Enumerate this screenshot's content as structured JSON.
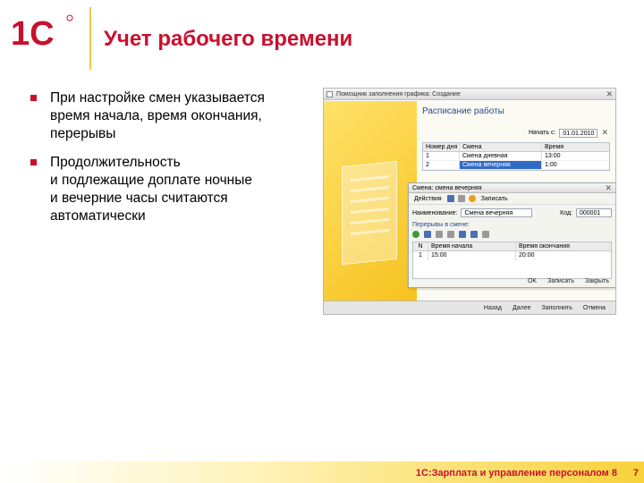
{
  "header": {
    "title": "Учет рабочего времени",
    "logo_text": "1С"
  },
  "bullets": [
    {
      "lines": [
        "При настройке смен указывается",
        "время начала, время окончания,",
        "перерывы"
      ]
    },
    {
      "lines": [
        "Продолжительность",
        "и подлежащие доплате ночные",
        "и вечерние часы считаются",
        "автоматически"
      ]
    }
  ],
  "screenshot": {
    "window_title": "Помощник заполнения графика: Создание",
    "schedule_title": "Расписание работы",
    "period_label": "Начать с:",
    "period_value": "01.01.2010",
    "grid_headers": [
      "Номер дня",
      "Смена",
      "Время"
    ],
    "grid_rows": [
      [
        "1",
        "Смена дневная",
        "13:00"
      ],
      [
        "2",
        "Смена вечерняя",
        "1:00"
      ]
    ],
    "inner": {
      "title": "Смена: смена вечерняя",
      "toolbar": [
        "Действия",
        "Записать"
      ],
      "name_label": "Наименование:",
      "name_value": "Смена вечерняя",
      "code_label": "Код:",
      "code_value": "000001",
      "breaks_label": "Перерывы в смене:",
      "grid_headers": [
        "N",
        "Время начала",
        "Время окончания"
      ],
      "grid_rows": [
        [
          "1",
          "15:00",
          "20:00"
        ]
      ],
      "buttons": [
        "OK",
        "Записать",
        "Закрыть"
      ]
    },
    "footer_buttons": [
      "Назад",
      "Далее",
      "Заполнить",
      "Отмена"
    ]
  },
  "footer": {
    "text": "1С:Зарплата и управление персоналом 8",
    "page_number": "7"
  },
  "colors": {
    "accent": "#c8102e",
    "gold": "#f7d23a"
  }
}
